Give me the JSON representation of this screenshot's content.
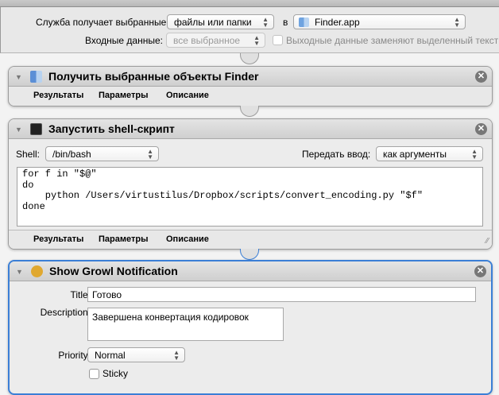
{
  "header": {
    "service_receives_label": "Служба получает выбранные",
    "service_receives_value": "файлы или папки",
    "in_label": "в",
    "app_value": "Finder.app",
    "input_label": "Входные данные:",
    "input_value": "все выбранное",
    "replace_label": "Выходные данные заменяют выделенный текст"
  },
  "actions": [
    {
      "title": "Получить выбранные объекты Finder",
      "tabs": [
        "Результаты",
        "Параметры",
        "Описание"
      ]
    },
    {
      "title": "Запустить shell-скрипт",
      "shell_label": "Shell:",
      "shell_value": "/bin/bash",
      "pass_label": "Передать ввод:",
      "pass_value": "как аргументы",
      "script": [
        "for f in \"$@\"",
        "do",
        "    python /Users/virtustilus/Dropbox/scripts/convert_encoding.py \"$f\"",
        "done"
      ],
      "tabs": [
        "Результаты",
        "Параметры",
        "Описание"
      ]
    },
    {
      "title": "Show Growl Notification",
      "title_label": "Title:",
      "title_value": "Готово",
      "description_label": "Description:",
      "description_value": "Завершена конвертация кодировок",
      "priority_label": "Priority:",
      "priority_value": "Normal",
      "sticky_label": "Sticky"
    }
  ],
  "colors": {
    "selected_border": "#3b7fd6"
  }
}
